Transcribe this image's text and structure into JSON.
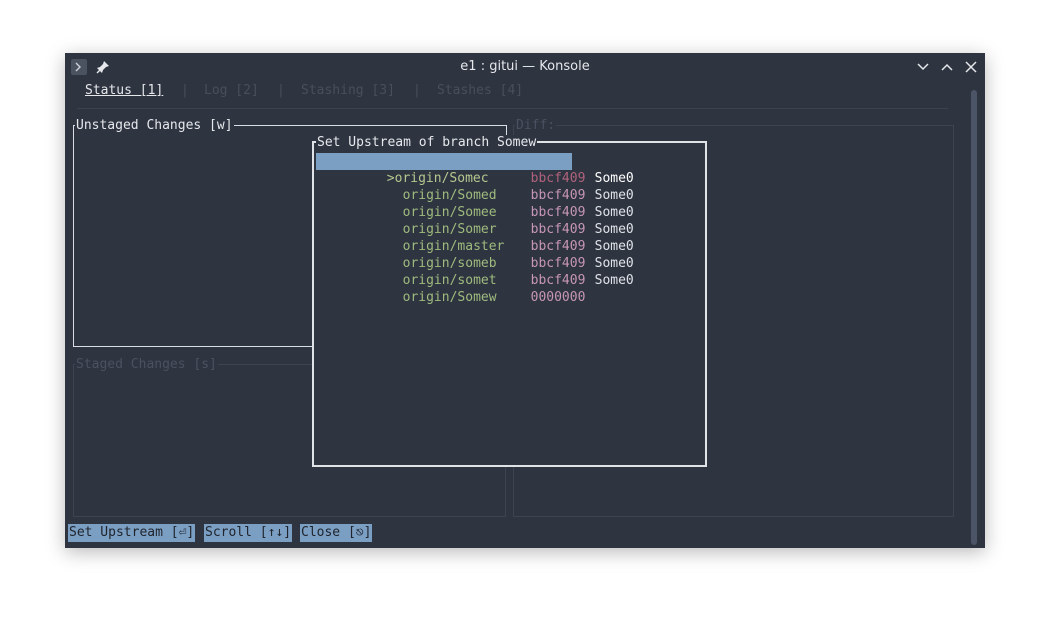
{
  "window": {
    "title": "e1 : gitui — Konsole",
    "icons": [
      "terminal-icon",
      "pin-icon",
      "minimize-icon",
      "maximize-icon",
      "close-icon"
    ]
  },
  "tabs": [
    {
      "label": "Status [1]",
      "active": true
    },
    {
      "label": "Log [2]",
      "active": false
    },
    {
      "label": "Stashing [3]",
      "active": false
    },
    {
      "label": "Stashes [4]",
      "active": false
    }
  ],
  "tab_separator": "|",
  "panels": {
    "unstaged_title": "Unstaged Changes [w]",
    "staged_title": "Staged Changes [s]",
    "diff_title": "Diff:"
  },
  "popup": {
    "title": "Set Upstream of branch Somew",
    "rows": [
      {
        "marker": ">",
        "branch": "origin/Somec",
        "hash": "bbcf409",
        "author": "Some0",
        "selected": true
      },
      {
        "marker": "",
        "branch": "origin/Somed",
        "hash": "bbcf409",
        "author": "Some0",
        "selected": false
      },
      {
        "marker": "",
        "branch": "origin/Somee",
        "hash": "bbcf409",
        "author": "Some0",
        "selected": false
      },
      {
        "marker": "",
        "branch": "origin/Somer",
        "hash": "bbcf409",
        "author": "Some0",
        "selected": false
      },
      {
        "marker": "",
        "branch": "origin/master",
        "hash": "bbcf409",
        "author": "Some0",
        "selected": false
      },
      {
        "marker": "",
        "branch": "origin/someb",
        "hash": "bbcf409",
        "author": "Some0",
        "selected": false
      },
      {
        "marker": "",
        "branch": "origin/somet",
        "hash": "bbcf409",
        "author": "Some0",
        "selected": false
      },
      {
        "marker": "",
        "branch": "origin/Somew",
        "hash": "0000000",
        "author": "",
        "selected": false
      }
    ]
  },
  "footer": {
    "set_upstream": "Set Upstream [⏎]",
    "scroll": "Scroll [↑↓]",
    "close": "Close [⎋]"
  },
  "colors": {
    "terminal_bg": "#2e3440",
    "selection_bg": "#7b9ec3",
    "branch_green": "#9fbb7e",
    "hash_pink": "#c796b6"
  }
}
